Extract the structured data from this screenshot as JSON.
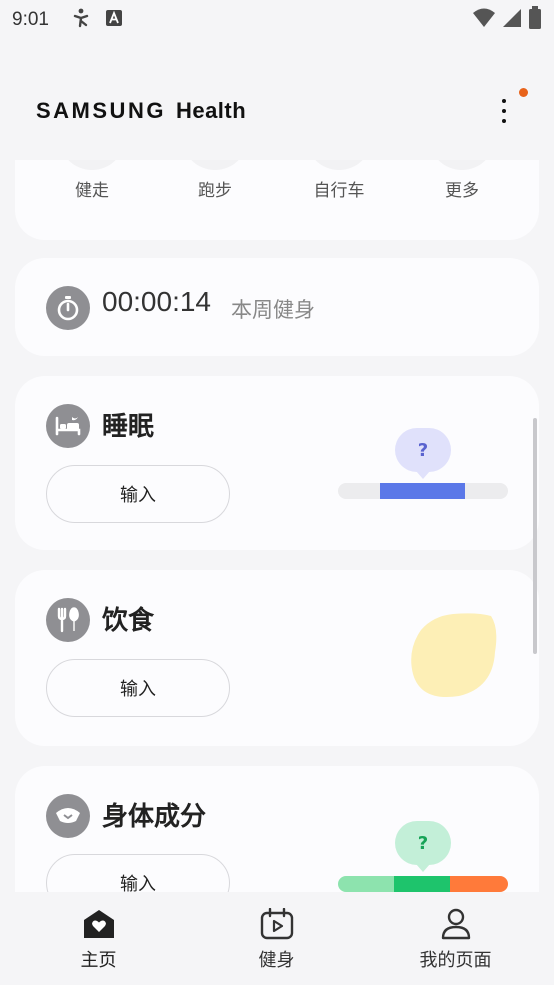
{
  "status_bar": {
    "time": "9:01",
    "icons": [
      "accessibility-icon",
      "a-letter-icon",
      "wifi-icon",
      "signal-icon",
      "battery-icon"
    ]
  },
  "header": {
    "brand_samsung": "SAMSUNG",
    "brand_health": "Health",
    "notification_color": "#e8631a"
  },
  "quick_start": {
    "items": [
      {
        "label": "健走"
      },
      {
        "label": "跑步"
      },
      {
        "label": "自行车"
      },
      {
        "label": "更多"
      }
    ]
  },
  "exercise_timer": {
    "value": "00:00:14",
    "label": "本周健身",
    "icon": "stopwatch-icon"
  },
  "sleep": {
    "title": "睡眠",
    "input_label": "输入",
    "icon": "bed-icon",
    "bubble": "?",
    "bubble_color": "#e0e1fb",
    "bar_color": "#5b78e8"
  },
  "food": {
    "title": "饮食",
    "input_label": "输入",
    "icon": "fork-knife-icon",
    "blob_color": "#fdefb6"
  },
  "body_composition": {
    "title": "身体成分",
    "input_label": "输入",
    "icon": "body-scale-icon",
    "bubble": "?",
    "bubble_color": "#c3efd8",
    "bar_colors": [
      "#8de3ae",
      "#1ec46c",
      "#ff7a3a"
    ]
  },
  "bottom_nav": {
    "items": [
      {
        "label": "主页",
        "icon": "home-heart-icon",
        "active": true
      },
      {
        "label": "健身",
        "icon": "fitness-calendar-icon",
        "active": false
      },
      {
        "label": "我的页面",
        "icon": "person-icon",
        "active": false
      }
    ]
  }
}
